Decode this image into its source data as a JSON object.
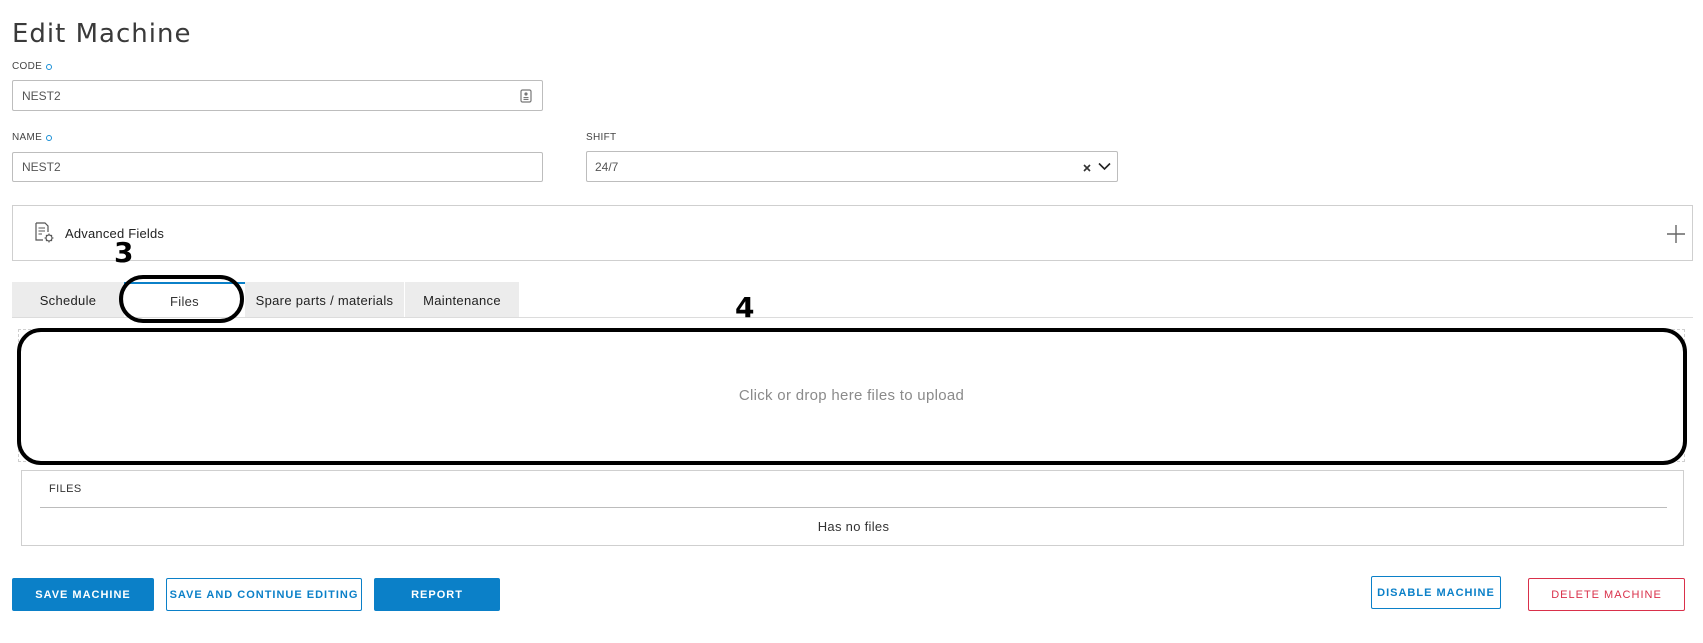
{
  "page": {
    "title": "Edit Machine"
  },
  "form": {
    "code": {
      "label": "CODE",
      "value": "NEST2"
    },
    "name": {
      "label": "NAME",
      "value": "NEST2"
    },
    "shift": {
      "label": "SHIFT",
      "value": "24/7"
    }
  },
  "advanced": {
    "label": "Advanced Fields"
  },
  "tabs": [
    {
      "label": "Schedule"
    },
    {
      "label": "Files"
    },
    {
      "label": "Spare parts / materials"
    },
    {
      "label": "Maintenance"
    }
  ],
  "upload": {
    "prompt": "Click or drop here files to upload"
  },
  "files_table": {
    "header": "FILES",
    "empty_text": "Has no files"
  },
  "buttons": {
    "save": "SAVE MACHINE",
    "save_continue": "SAVE AND CONTINUE EDITING",
    "report": "REPORT",
    "disable": "DISABLE MACHINE",
    "delete": "DELETE MACHINE"
  },
  "annotations": {
    "three": "3",
    "four": "4"
  },
  "colors": {
    "primary": "#0b80c8",
    "danger": "#d9304a",
    "required": "#1a8fd6"
  }
}
